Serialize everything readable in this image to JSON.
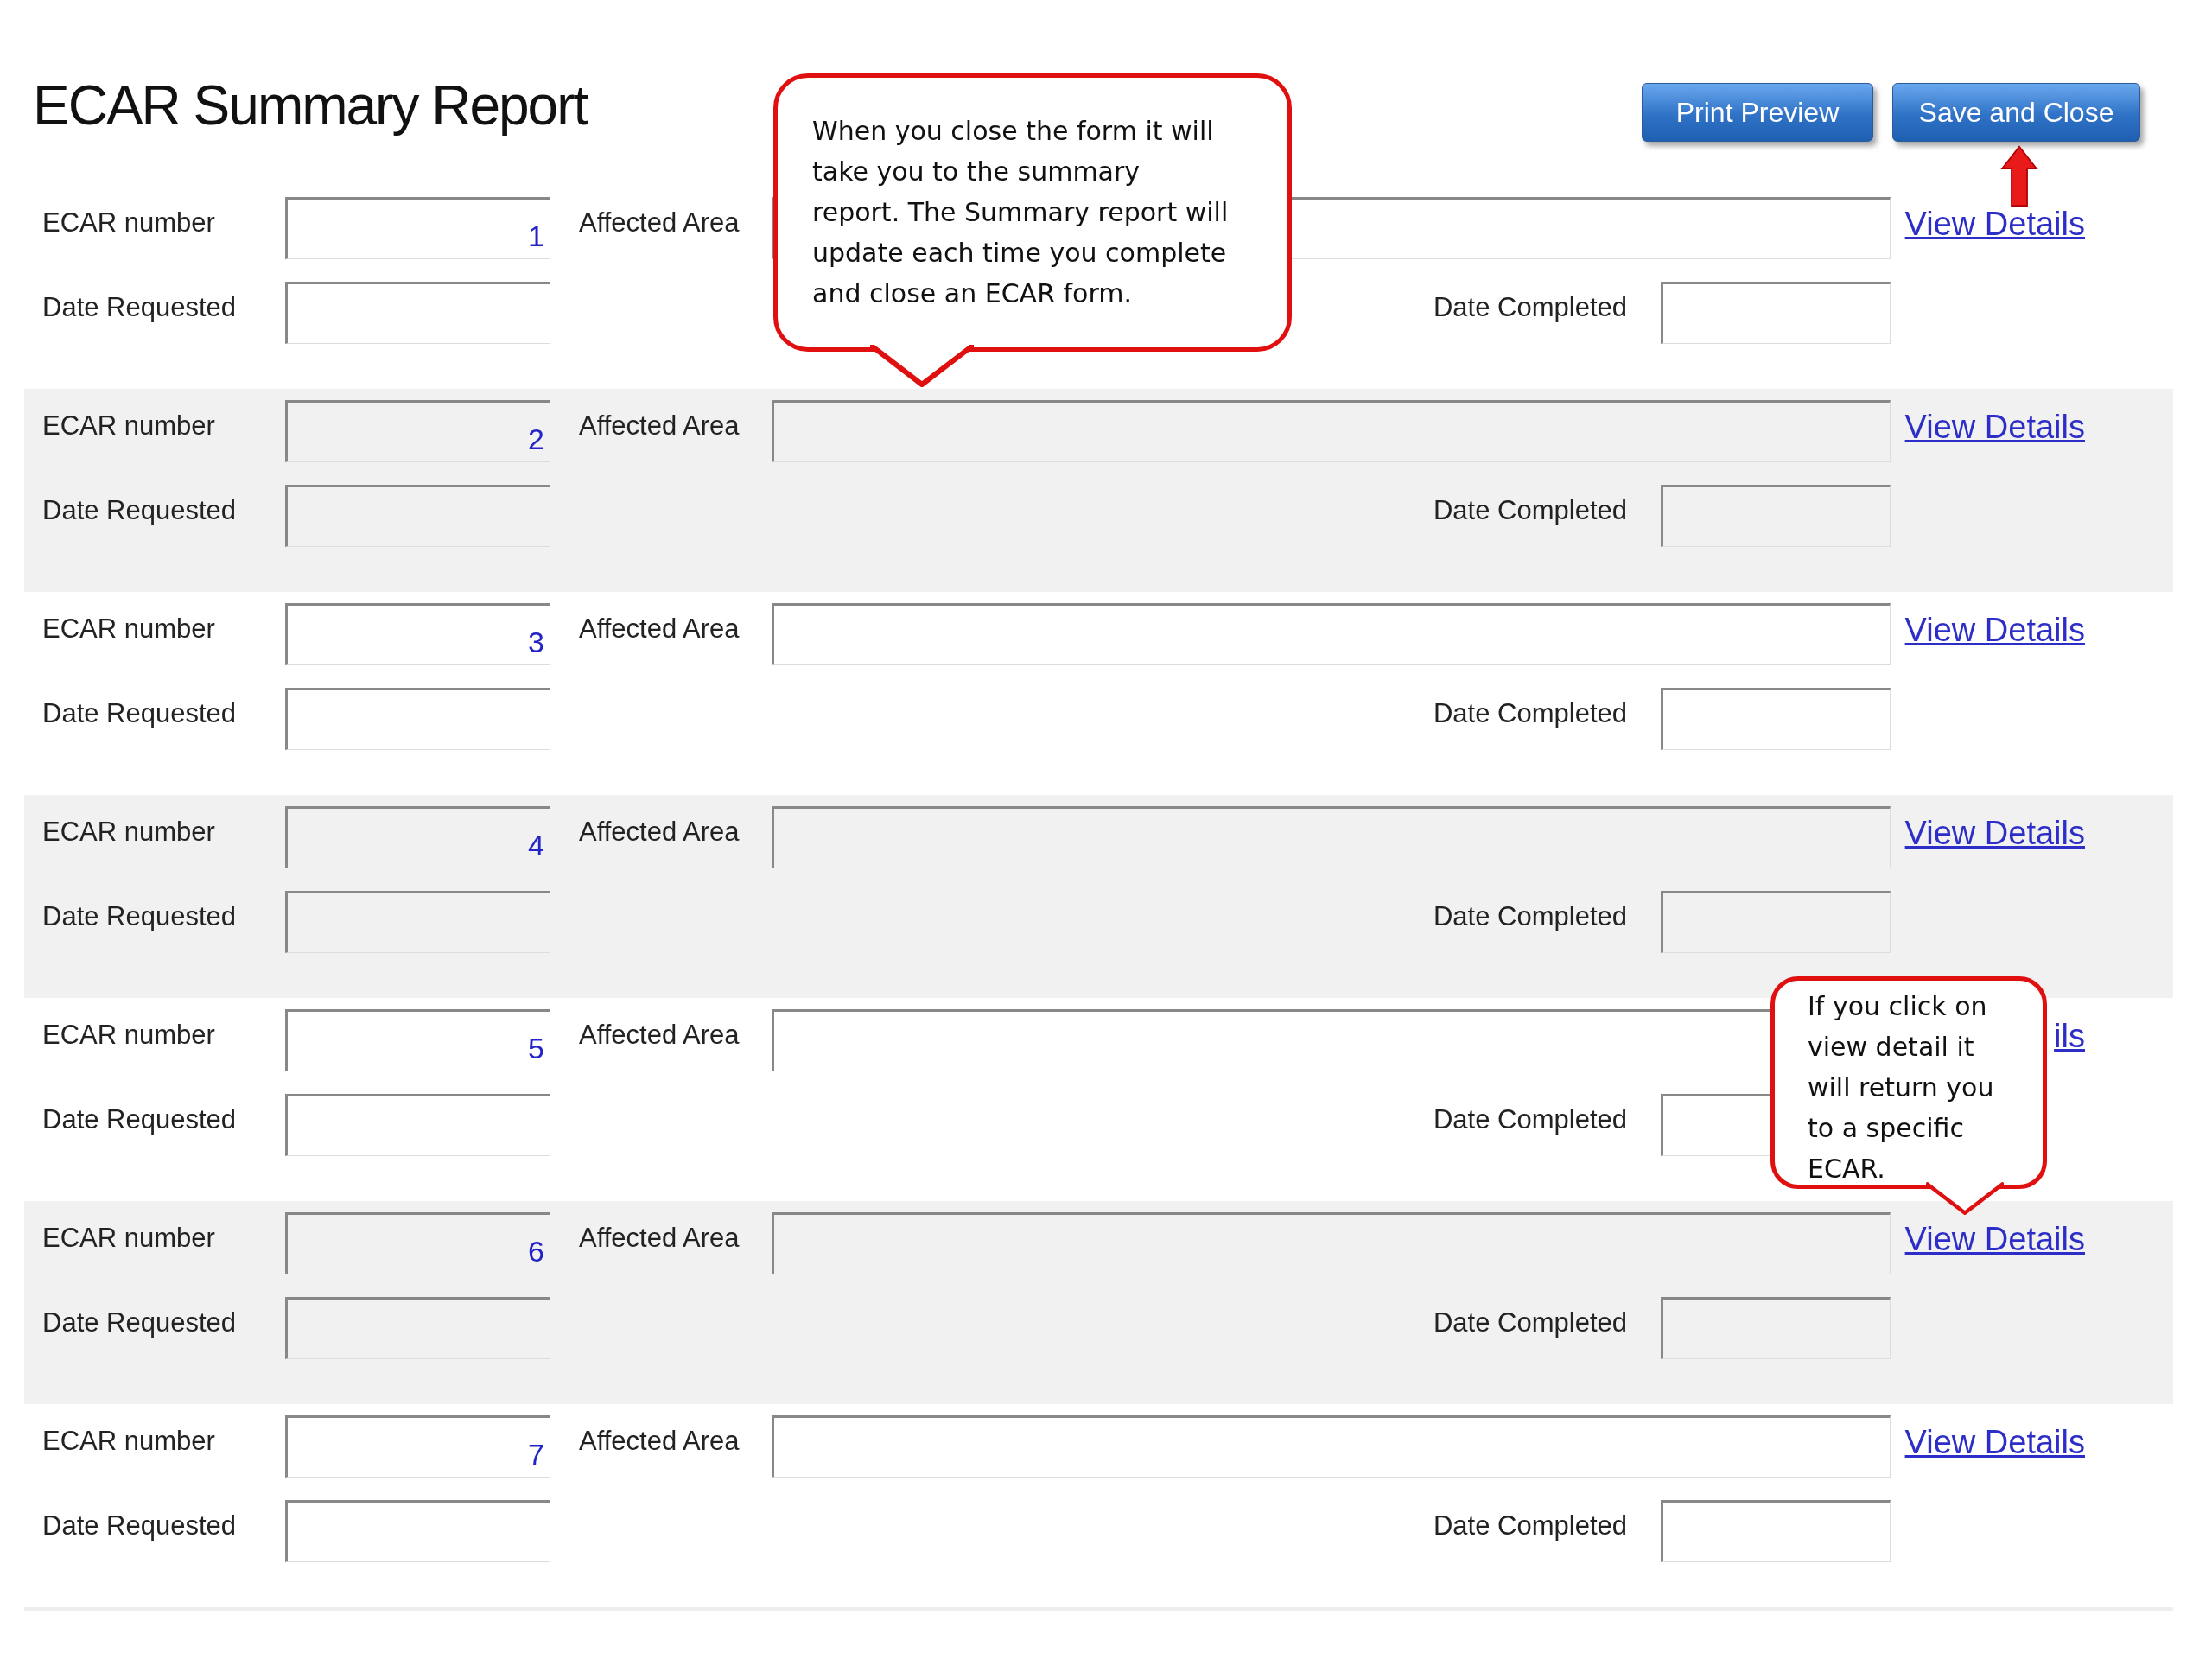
{
  "title": "ECAR Summary Report",
  "buttons": [
    "Print Preview",
    "Save and Close"
  ],
  "records": [
    {
      "number_label": "ECAR number",
      "number": "1",
      "area_label": "Affected Area",
      "requested_label": "Date Requested",
      "completed_label": "Date Completed",
      "link": "View Details"
    },
    {
      "number_label": "ECAR number",
      "number": "2",
      "area_label": "Affected Area",
      "requested_label": "Date Requested",
      "completed_label": "Date Completed",
      "link": "View Details"
    },
    {
      "number_label": "ECAR number",
      "number": "3",
      "area_label": "Affected Area",
      "requested_label": "Date Requested",
      "completed_label": "Date Completed",
      "link": "View Details"
    },
    {
      "number_label": "ECAR number",
      "number": "4",
      "area_label": "Affected Area",
      "requested_label": "Date Requested",
      "completed_label": "Date Completed",
      "link": "View Details"
    },
    {
      "number_label": "ECAR number",
      "number": "5",
      "area_label": "Affected Area",
      "requested_label": "Date Requested",
      "completed_label": "Date Completed",
      "link": "ils"
    },
    {
      "number_label": "ECAR number",
      "number": "6",
      "area_label": "Affected Area",
      "requested_label": "Date Requested",
      "completed_label": "Date Completed",
      "link": "View Details"
    },
    {
      "number_label": "ECAR number",
      "number": "7",
      "area_label": "Affected Area",
      "requested_label": "Date Requested",
      "completed_label": "Date Completed",
      "link": "View Details"
    }
  ],
  "callouts": [
    {
      "text": "When you close the form it will\ntake you to the summary\nreport. The Summary report will\nupdate each time you complete\nand close an ECAR form."
    },
    {
      "text": "If you click on\nview detail it\nwill return you\nto a specific\nECAR."
    }
  ]
}
